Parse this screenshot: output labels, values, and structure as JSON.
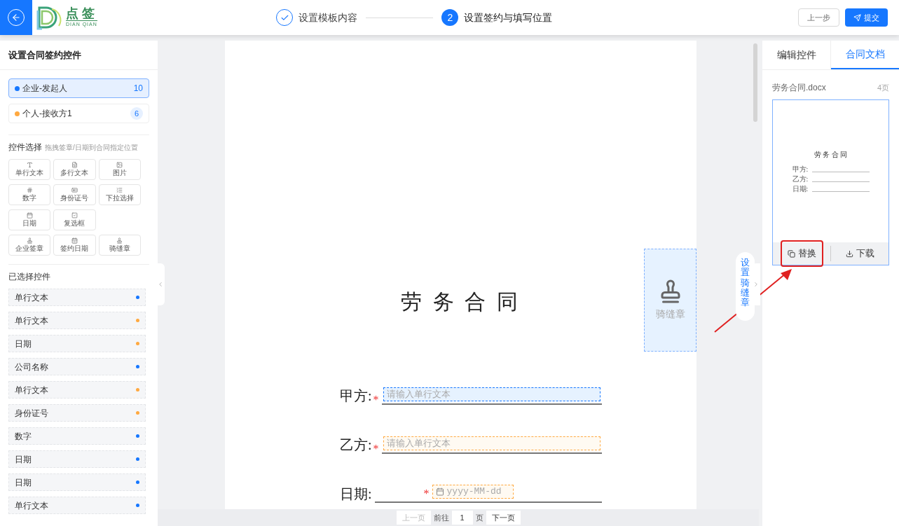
{
  "header": {
    "logo": {
      "name": "点 签",
      "sub": "DIAN QIAN"
    },
    "steps": [
      {
        "label": "设置模板内容",
        "done": true,
        "selected": false
      },
      {
        "label": "设置签约与填写位置",
        "number": "2",
        "done": false,
        "selected": true
      }
    ],
    "buttons": [
      {
        "label": "上一步",
        "kind": "secondary"
      },
      {
        "label": "提交",
        "kind": "primary"
      }
    ]
  },
  "left_panel": {
    "title": "设置合同签约控件",
    "signers": [
      {
        "name": "企业-发起人",
        "count": "10",
        "color": "#1677ff",
        "selected": true
      },
      {
        "name": "个人-接收方1",
        "count": "6",
        "color": "#ffa940",
        "selected": false
      }
    ],
    "palette_title": "控件选择",
    "palette_hint": "拖拽签章/日期到合同指定位置",
    "palette_rows": [
      [
        {
          "label": "单行文本",
          "kind": "text"
        },
        {
          "label": "多行文本",
          "kind": "multitext"
        },
        {
          "label": "图片",
          "kind": "image"
        }
      ],
      [
        {
          "label": "数字",
          "kind": "number"
        },
        {
          "label": "身份证号",
          "kind": "id"
        },
        {
          "label": "下拉选择",
          "kind": "select"
        }
      ],
      [
        {
          "label": "日期",
          "kind": "date"
        },
        {
          "label": "复选框",
          "kind": "checkbox"
        }
      ],
      [
        {
          "label": "企业签章",
          "kind": "seal"
        },
        {
          "label": "签约日期",
          "kind": "signdate"
        },
        {
          "label": "骑缝章",
          "kind": "seal"
        }
      ]
    ],
    "selected_title": "已选择控件",
    "selected_controls": [
      {
        "label": "单行文本",
        "color": "#1677ff"
      },
      {
        "label": "单行文本",
        "color": "#ffa940"
      },
      {
        "label": "日期",
        "color": "#ffa940"
      },
      {
        "label": "公司名称",
        "color": "#1677ff"
      },
      {
        "label": "单行文本",
        "color": "#ffa940"
      },
      {
        "label": "身份证号",
        "color": "#ffa940"
      },
      {
        "label": "数字",
        "color": "#1677ff"
      },
      {
        "label": "日期",
        "color": "#1677ff"
      },
      {
        "label": "日期",
        "color": "#1677ff"
      },
      {
        "label": "单行文本",
        "color": "#1677ff"
      }
    ]
  },
  "document": {
    "title": "劳 务 合 同",
    "fields": [
      {
        "label": "甲方:",
        "required_mark": "*",
        "kind": "text",
        "placeholder": "请输入单行文本",
        "color": "#1677ff"
      },
      {
        "label": "乙方:",
        "required_mark": "*",
        "kind": "text",
        "placeholder": "请输入单行文本",
        "color": "#ffa940"
      },
      {
        "label": "日期:",
        "required_mark": "*",
        "kind": "date",
        "placeholder": "yyyy-MM-dd",
        "color": "#ffa940"
      }
    ],
    "seam_seal": {
      "label": "骑缝章"
    },
    "side_tab": "设置骑缝章",
    "pagination": {
      "prev": "上一页",
      "prev_disabled": true,
      "goto": "前往",
      "page": "1",
      "unit": "页",
      "next": "下一页"
    }
  },
  "right_panel": {
    "tabs": [
      {
        "label": "编辑控件",
        "selected": false
      },
      {
        "label": "合同文档",
        "selected": true
      }
    ],
    "file": {
      "name": "劳务合同.docx",
      "pages": "4页",
      "thumbnail": {
        "title": "劳 务 合 同",
        "lines": [
          "甲方:",
          "乙方:",
          "日期:"
        ]
      },
      "actions": [
        {
          "label": "替换",
          "kind": "replace",
          "highlighted": true
        },
        {
          "label": "下载",
          "kind": "download",
          "highlighted": false
        }
      ]
    }
  }
}
